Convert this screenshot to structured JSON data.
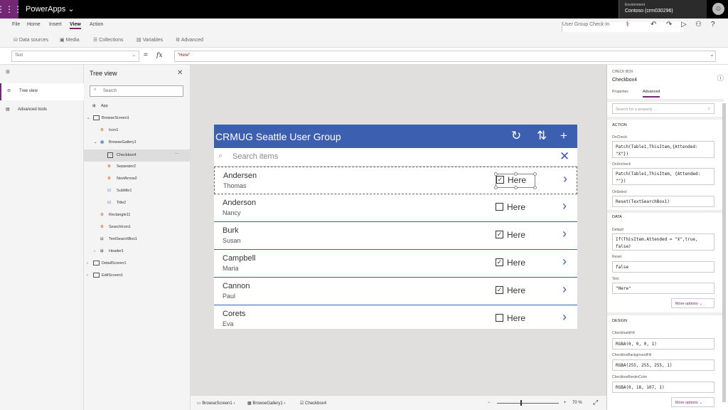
{
  "app_title": "PowerApps",
  "environment": {
    "label": "Environment",
    "name": "Contoso (crm030296)"
  },
  "menu": {
    "file": "File",
    "home": "Home",
    "insert": "Insert",
    "view": "View",
    "action": "Action",
    "app_name": "User Group Check-In",
    "toolbar": {
      "checker": "⚕",
      "undo": "↶",
      "redo": "↷",
      "play": "▷",
      "user": "⚇",
      "help": "?"
    }
  },
  "ribbon": {
    "data_sources": "Data sources",
    "media": "Media",
    "collections": "Collections",
    "variables": "Variables",
    "advanced": "Advanced"
  },
  "formula": {
    "property": "Text",
    "fx": "fx",
    "value": "\"Here\""
  },
  "leftnav": {
    "tree_view": "Tree view",
    "advanced_tools": "Advanced tools"
  },
  "tree": {
    "title": "Tree view",
    "search_placeholder": "Search",
    "app": "App",
    "nodes": [
      "BrowseScreen1",
      "Icon1",
      "BrowseGallery1",
      "Checkbox4",
      "Separator2",
      "NextArrow2",
      "Subtitle1",
      "Title2",
      "Rectangle11",
      "SearchIcon1",
      "TextSearchBox1",
      "Header1",
      "DetailScreen1",
      "EditScreen1"
    ]
  },
  "appscreen": {
    "title": "CRMUG Seattle User Group",
    "search_placeholder": "Search items",
    "rows": [
      {
        "last": "Andersen",
        "first": "Thomas",
        "checked": "✓",
        "label": "Here"
      },
      {
        "last": "Anderson",
        "first": "Nancy",
        "checked": "",
        "label": "Here"
      },
      {
        "last": "Burk",
        "first": "Susan",
        "checked": "✓",
        "label": "Here"
      },
      {
        "last": "Campbell",
        "first": "Maria",
        "checked": "✓",
        "label": "Here"
      },
      {
        "last": "Cannon",
        "first": "Paul",
        "checked": "✓",
        "label": "Here"
      },
      {
        "last": "Corets",
        "first": "Eva",
        "checked": "",
        "label": "Here"
      }
    ]
  },
  "panel": {
    "type": "CHECK BOX",
    "name": "Checkbox4",
    "tab_properties": "Properties",
    "tab_advanced": "Advanced",
    "search_placeholder": "Search for a property ...",
    "action": "ACTION",
    "oncheck_label": "OnCheck",
    "oncheck": "Patch(Table1,ThisItem,{Attended: \"X\"})",
    "onuncheck_label": "OnUncheck",
    "onuncheck": "Patch(Table1,ThisItem, {Attended: \"\"})",
    "onselect_label": "OnSelect",
    "onselect": "Reset(TextSearchBox1)",
    "data": "DATA",
    "default_label": "Default",
    "default": "If(ThisItem.Attended = \"X\",true, false)",
    "reset_label": "Reset",
    "reset": "false",
    "text_label": "Text",
    "text": "\"Here\"",
    "more_options": "More options",
    "design": "DESIGN",
    "checkmarkfill_label": "CheckmarkFill",
    "checkmarkfill": "RGBA(0, 0, 0, 1)",
    "cbbg_label": "CheckboxBackgroundFill",
    "cbbg": "RGBA(255, 255, 255, 1)",
    "cbborder_label": "CheckboxBorderColor",
    "cbborder": "RGBA(0, 18, 107, 1)"
  },
  "status": {
    "crumb1": "BrowseScreen1",
    "crumb2": "BrowseGallery1",
    "crumb3": "Checkbox4",
    "zoom": "70 %",
    "minus": "−",
    "plus": "+"
  },
  "colors": {
    "brand": "#742774",
    "header": "#3c5fb0"
  }
}
